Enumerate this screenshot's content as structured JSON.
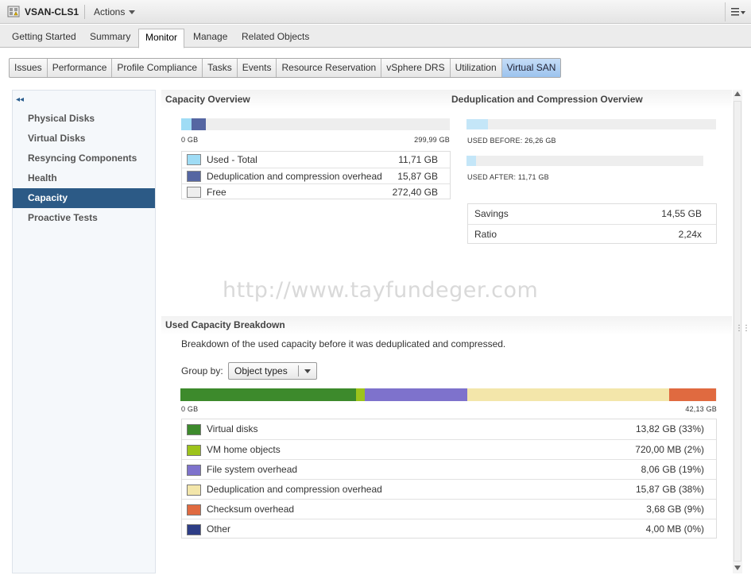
{
  "header": {
    "title": "VSAN-CLS1",
    "actions_label": "Actions"
  },
  "tabs": [
    {
      "label": "Getting Started"
    },
    {
      "label": "Summary"
    },
    {
      "label": "Monitor",
      "active": true
    },
    {
      "label": "Manage"
    },
    {
      "label": "Related Objects"
    }
  ],
  "subtabs": [
    {
      "label": "Issues"
    },
    {
      "label": "Performance"
    },
    {
      "label": "Profile Compliance"
    },
    {
      "label": "Tasks"
    },
    {
      "label": "Events"
    },
    {
      "label": "Resource Reservation"
    },
    {
      "label": "vSphere DRS"
    },
    {
      "label": "Utilization"
    },
    {
      "label": "Virtual SAN",
      "active": true
    }
  ],
  "nav": {
    "collapse_glyph": "◂◂",
    "items": [
      {
        "label": "Physical Disks"
      },
      {
        "label": "Virtual Disks"
      },
      {
        "label": "Resyncing Components"
      },
      {
        "label": "Health"
      },
      {
        "label": "Capacity",
        "active": true
      },
      {
        "label": "Proactive Tests"
      }
    ]
  },
  "capacity_overview": {
    "title": "Capacity Overview",
    "min_label": "0 GB",
    "max_label": "299,99 GB",
    "total_gb": 299.99,
    "segments": [
      {
        "name": "Used - Total",
        "value": "11,71 GB",
        "gb": 11.71,
        "color": "#9fdcf5"
      },
      {
        "name": "Deduplication and compression overhead",
        "value": "15,87 GB",
        "gb": 15.87,
        "color": "#5566a2"
      },
      {
        "name": "Free",
        "value": "272,40 GB",
        "gb": 272.4,
        "color": "#eeeeee"
      }
    ]
  },
  "dedup_overview": {
    "title": "Deduplication and Compression Overview",
    "before_label": "USED BEFORE: 26,26 GB",
    "after_label": "USED AFTER: 11,71 GB",
    "before_fraction": 0.087,
    "after_fraction": 0.04,
    "bar_color": "#c4e6f8",
    "rows": [
      {
        "name": "Savings",
        "value": "14,55 GB"
      },
      {
        "name": "Ratio",
        "value": "2,24x"
      }
    ]
  },
  "watermark": "http://www.tayfundeger.com",
  "breakdown": {
    "title": "Used Capacity Breakdown",
    "description": "Breakdown of the used capacity before it was deduplicated and compressed.",
    "group_by_label": "Group by:",
    "group_by_value": "Object types",
    "min_label": "0 GB",
    "max_label": "42,13 GB",
    "items": [
      {
        "name": "Virtual disks",
        "value": "13,82 GB (33%)",
        "pct": 32.8,
        "color": "#3d8a2c"
      },
      {
        "name": "VM home objects",
        "value": "720,00 MB (2%)",
        "pct": 1.7,
        "color": "#9dc31b"
      },
      {
        "name": "File system overhead",
        "value": "8,06 GB (19%)",
        "pct": 19.1,
        "color": "#7e72cc"
      },
      {
        "name": "Deduplication and compression overhead",
        "value": "15,87 GB (38%)",
        "pct": 37.7,
        "color": "#f3e6aa"
      },
      {
        "name": "Checksum overhead",
        "value": "3,68 GB (9%)",
        "pct": 8.7,
        "color": "#e06a40"
      },
      {
        "name": "Other",
        "value": "4,00 MB (0%)",
        "pct": 0.0,
        "color": "#2d3d86"
      }
    ]
  }
}
